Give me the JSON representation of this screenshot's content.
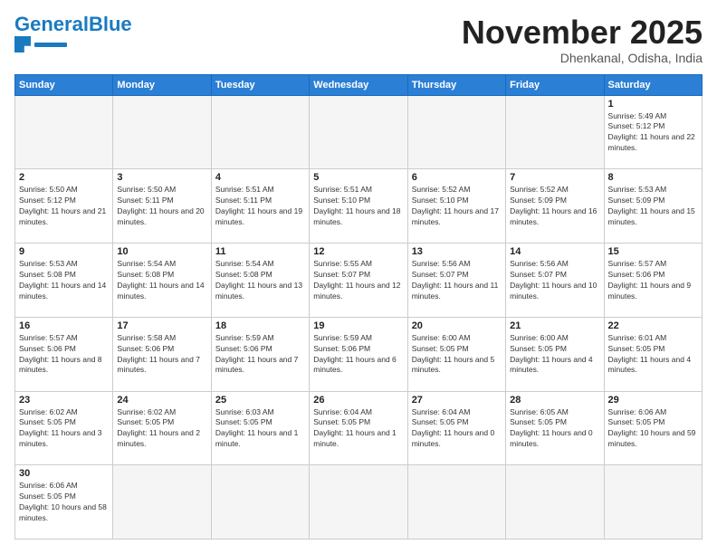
{
  "header": {
    "logo_general": "General",
    "logo_blue": "Blue",
    "month_title": "November 2025",
    "location": "Dhenkanal, Odisha, India"
  },
  "weekdays": [
    "Sunday",
    "Monday",
    "Tuesday",
    "Wednesday",
    "Thursday",
    "Friday",
    "Saturday"
  ],
  "cells": [
    {
      "day": "",
      "info": ""
    },
    {
      "day": "",
      "info": ""
    },
    {
      "day": "",
      "info": ""
    },
    {
      "day": "",
      "info": ""
    },
    {
      "day": "",
      "info": ""
    },
    {
      "day": "",
      "info": ""
    },
    {
      "day": "1",
      "info": "Sunrise: 5:49 AM\nSunset: 5:12 PM\nDaylight: 11 hours and 22 minutes."
    },
    {
      "day": "2",
      "info": "Sunrise: 5:50 AM\nSunset: 5:12 PM\nDaylight: 11 hours and 21 minutes."
    },
    {
      "day": "3",
      "info": "Sunrise: 5:50 AM\nSunset: 5:11 PM\nDaylight: 11 hours and 20 minutes."
    },
    {
      "day": "4",
      "info": "Sunrise: 5:51 AM\nSunset: 5:11 PM\nDaylight: 11 hours and 19 minutes."
    },
    {
      "day": "5",
      "info": "Sunrise: 5:51 AM\nSunset: 5:10 PM\nDaylight: 11 hours and 18 minutes."
    },
    {
      "day": "6",
      "info": "Sunrise: 5:52 AM\nSunset: 5:10 PM\nDaylight: 11 hours and 17 minutes."
    },
    {
      "day": "7",
      "info": "Sunrise: 5:52 AM\nSunset: 5:09 PM\nDaylight: 11 hours and 16 minutes."
    },
    {
      "day": "8",
      "info": "Sunrise: 5:53 AM\nSunset: 5:09 PM\nDaylight: 11 hours and 15 minutes."
    },
    {
      "day": "9",
      "info": "Sunrise: 5:53 AM\nSunset: 5:08 PM\nDaylight: 11 hours and 14 minutes."
    },
    {
      "day": "10",
      "info": "Sunrise: 5:54 AM\nSunset: 5:08 PM\nDaylight: 11 hours and 14 minutes."
    },
    {
      "day": "11",
      "info": "Sunrise: 5:54 AM\nSunset: 5:08 PM\nDaylight: 11 hours and 13 minutes."
    },
    {
      "day": "12",
      "info": "Sunrise: 5:55 AM\nSunset: 5:07 PM\nDaylight: 11 hours and 12 minutes."
    },
    {
      "day": "13",
      "info": "Sunrise: 5:56 AM\nSunset: 5:07 PM\nDaylight: 11 hours and 11 minutes."
    },
    {
      "day": "14",
      "info": "Sunrise: 5:56 AM\nSunset: 5:07 PM\nDaylight: 11 hours and 10 minutes."
    },
    {
      "day": "15",
      "info": "Sunrise: 5:57 AM\nSunset: 5:06 PM\nDaylight: 11 hours and 9 minutes."
    },
    {
      "day": "16",
      "info": "Sunrise: 5:57 AM\nSunset: 5:06 PM\nDaylight: 11 hours and 8 minutes."
    },
    {
      "day": "17",
      "info": "Sunrise: 5:58 AM\nSunset: 5:06 PM\nDaylight: 11 hours and 7 minutes."
    },
    {
      "day": "18",
      "info": "Sunrise: 5:59 AM\nSunset: 5:06 PM\nDaylight: 11 hours and 7 minutes."
    },
    {
      "day": "19",
      "info": "Sunrise: 5:59 AM\nSunset: 5:06 PM\nDaylight: 11 hours and 6 minutes."
    },
    {
      "day": "20",
      "info": "Sunrise: 6:00 AM\nSunset: 5:05 PM\nDaylight: 11 hours and 5 minutes."
    },
    {
      "day": "21",
      "info": "Sunrise: 6:00 AM\nSunset: 5:05 PM\nDaylight: 11 hours and 4 minutes."
    },
    {
      "day": "22",
      "info": "Sunrise: 6:01 AM\nSunset: 5:05 PM\nDaylight: 11 hours and 4 minutes."
    },
    {
      "day": "23",
      "info": "Sunrise: 6:02 AM\nSunset: 5:05 PM\nDaylight: 11 hours and 3 minutes."
    },
    {
      "day": "24",
      "info": "Sunrise: 6:02 AM\nSunset: 5:05 PM\nDaylight: 11 hours and 2 minutes."
    },
    {
      "day": "25",
      "info": "Sunrise: 6:03 AM\nSunset: 5:05 PM\nDaylight: 11 hours and 1 minute."
    },
    {
      "day": "26",
      "info": "Sunrise: 6:04 AM\nSunset: 5:05 PM\nDaylight: 11 hours and 1 minute."
    },
    {
      "day": "27",
      "info": "Sunrise: 6:04 AM\nSunset: 5:05 PM\nDaylight: 11 hours and 0 minutes."
    },
    {
      "day": "28",
      "info": "Sunrise: 6:05 AM\nSunset: 5:05 PM\nDaylight: 11 hours and 0 minutes."
    },
    {
      "day": "29",
      "info": "Sunrise: 6:06 AM\nSunset: 5:05 PM\nDaylight: 10 hours and 59 minutes."
    },
    {
      "day": "30",
      "info": "Sunrise: 6:06 AM\nSunset: 5:05 PM\nDaylight: 10 hours and 58 minutes."
    },
    {
      "day": "",
      "info": ""
    },
    {
      "day": "",
      "info": ""
    },
    {
      "day": "",
      "info": ""
    },
    {
      "day": "",
      "info": ""
    },
    {
      "day": "",
      "info": ""
    },
    {
      "day": "",
      "info": ""
    }
  ]
}
